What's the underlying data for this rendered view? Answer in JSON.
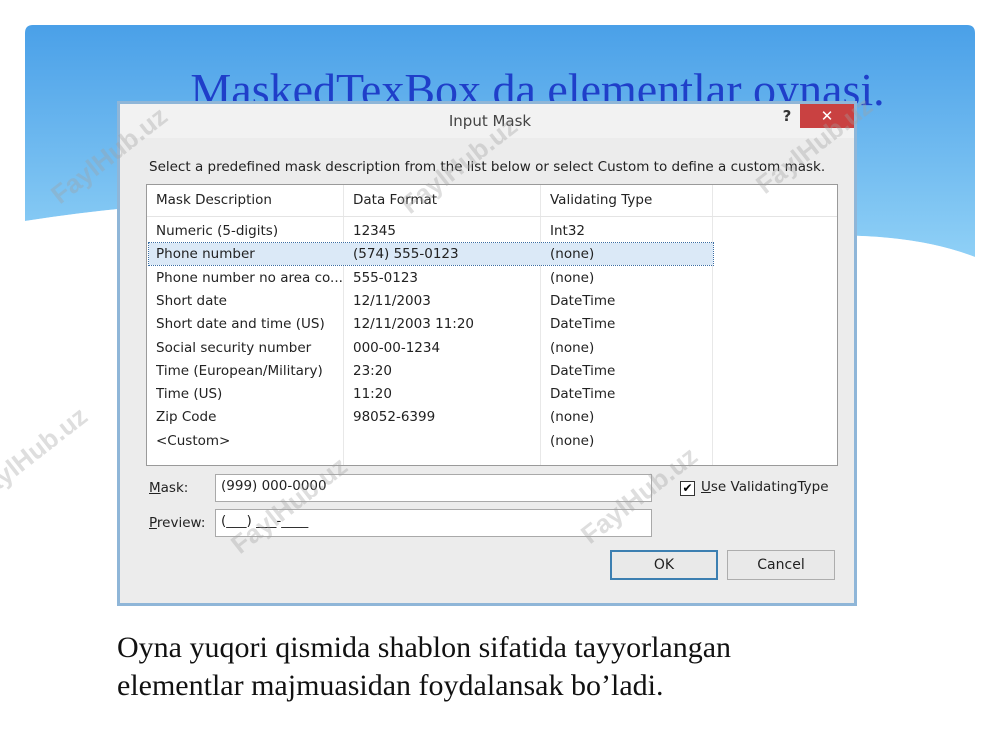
{
  "slide": {
    "title": "MaskedTexBox da elementlar oynasi.",
    "caption_line1": "Oyna yuqori qismida shablon sifatida tayyorlangan",
    "caption_line2": "elementlar majmuasidan foydalansak bo’ladi.",
    "watermark": "FaylHub.uz",
    "accent_color": "#4da3e6"
  },
  "dialog": {
    "title": "Input Mask",
    "help_label": "?",
    "close_label": "✕",
    "instruction": "Select a predefined mask description from the list below or select Custom to define a custom mask.",
    "columns": [
      "Mask Description",
      "Data Format",
      "Validating Type"
    ],
    "rows": [
      {
        "desc": "Numeric (5-digits)",
        "format": "12345",
        "type": "Int32",
        "selected": false
      },
      {
        "desc": "Phone number",
        "format": "(574) 555-0123",
        "type": "(none)",
        "selected": true
      },
      {
        "desc": "Phone number no area co...",
        "format": "555-0123",
        "type": "(none)",
        "selected": false
      },
      {
        "desc": "Short date",
        "format": "12/11/2003",
        "type": "DateTime",
        "selected": false
      },
      {
        "desc": "Short date and time (US)",
        "format": "12/11/2003 11:20",
        "type": "DateTime",
        "selected": false
      },
      {
        "desc": "Social security number",
        "format": "000-00-1234",
        "type": "(none)",
        "selected": false
      },
      {
        "desc": "Time (European/Military)",
        "format": "23:20",
        "type": "DateTime",
        "selected": false
      },
      {
        "desc": "Time (US)",
        "format": "11:20",
        "type": "DateTime",
        "selected": false
      },
      {
        "desc": "Zip Code",
        "format": "98052-6399",
        "type": "(none)",
        "selected": false
      },
      {
        "desc": "<Custom>",
        "format": "",
        "type": "(none)",
        "selected": false
      }
    ],
    "mask_label": "Mask:",
    "mask_value": "(999) 000-0000",
    "preview_label": "Preview:",
    "preview_value": "(___) ___-____",
    "use_validating_label": "Use ValidatingType",
    "use_validating_checked": true,
    "check_glyph": "✔",
    "ok_label": "OK",
    "cancel_label": "Cancel"
  }
}
